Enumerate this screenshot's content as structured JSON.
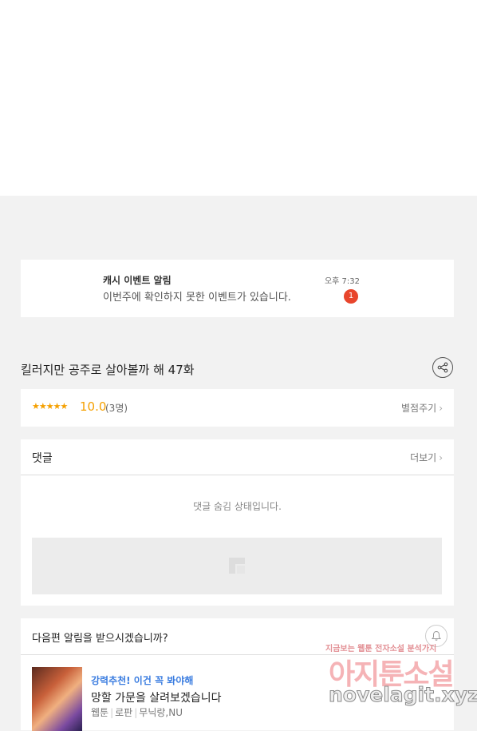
{
  "notification": {
    "title": "캐시 이벤트 알림",
    "body": "이번주에 확인하지 못한 이벤트가 있습니다.",
    "time": "오후 7:32",
    "badge": "1"
  },
  "episode": {
    "title": "킬러지만 공주로 살아볼까 해 47화",
    "share_icon": "share-icon"
  },
  "rating": {
    "stars": "★★★★★",
    "score": "10.0",
    "count": "(3명)",
    "rate_label": "별점주기"
  },
  "comments": {
    "title": "댓글",
    "more_label": "더보기",
    "hidden_text": "댓글 숨김 상태입니다."
  },
  "next_episode": {
    "question": "다음편 알림을 받으시겠습니까?",
    "bell_icon": "bell-icon",
    "recommend_label": "강력추천! 이건 꼭 봐야해",
    "recommend_title": "망할 가문을 살려보겠습니다",
    "tags": [
      "웹툰",
      "로판",
      "무닉랑,NU"
    ]
  },
  "watermark": {
    "top_line": "지금보는 웹툰 전자소설 분석가지",
    "big": "아지툰소설",
    "url": "novelagit.xyz"
  },
  "colors": {
    "accent_star": "#f5a000",
    "badge": "#e8452c",
    "link_blue": "#3b7de0",
    "background": "#f2f2f2"
  }
}
